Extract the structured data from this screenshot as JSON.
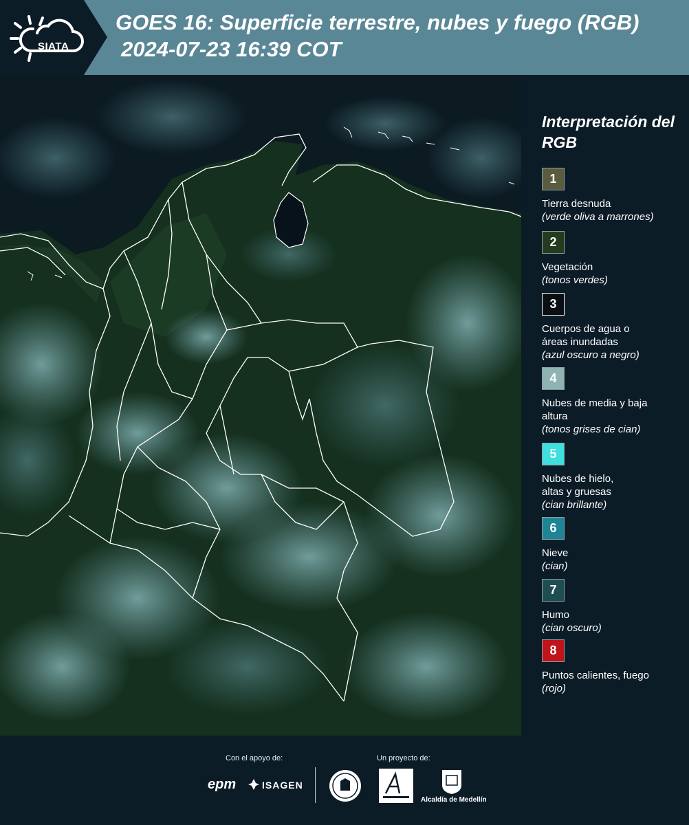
{
  "header": {
    "logo_text": "SIATA",
    "title": "GOES 16: Superficie terrestre, nubes y fuego (RGB)",
    "subtitle": "2024-07-23 16:39 COT",
    "band_color": "#0c1c27",
    "bg_color": "#5a8796"
  },
  "map": {
    "description_icon": "satellite-rgb-map",
    "land_color": "#14301e",
    "cloud_color": "#7fb3b8",
    "ocean_color": "#0b1a22",
    "border_color": "#ffffff"
  },
  "legend": {
    "title": "Interpretación del RGB",
    "items": [
      {
        "number": "1",
        "label": "Tierra desnuda",
        "sub": "(verde oliva a marrones)",
        "color": "#5b5b40"
      },
      {
        "number": "2",
        "label": "Vegetación",
        "sub": "(tonos verdes)",
        "color": "#253b1d"
      },
      {
        "number": "3",
        "label": "Cuerpos de agua o áreas inundadas",
        "sub": "(azul oscuro a negro)",
        "color": "#0a0f14"
      },
      {
        "number": "4",
        "label": "Nubes de media y baja altura",
        "sub": "(tonos grises de cian)",
        "color": "#8fb3b3"
      },
      {
        "number": "5",
        "label": "Nubes de hielo, altas y gruesas",
        "sub": "(cian brillante)",
        "color": "#3ee0de"
      },
      {
        "number": "6",
        "label": "Nieve",
        "sub": "(cian)",
        "color": "#1f8596"
      },
      {
        "number": "7",
        "label": "Humo",
        "sub": "(cian oscuro)",
        "color": "#1e4e50"
      },
      {
        "number": "8",
        "label": "Puntos calientes, fuego",
        "sub": "(rojo)",
        "color": "#c0141a"
      }
    ]
  },
  "footer": {
    "support_label": "Con el apoyo de:",
    "project_label": "Un proyecto de:",
    "epm": "epm",
    "isagen": "ISAGEN",
    "alcaldia": "Alcaldía de Medellín"
  }
}
